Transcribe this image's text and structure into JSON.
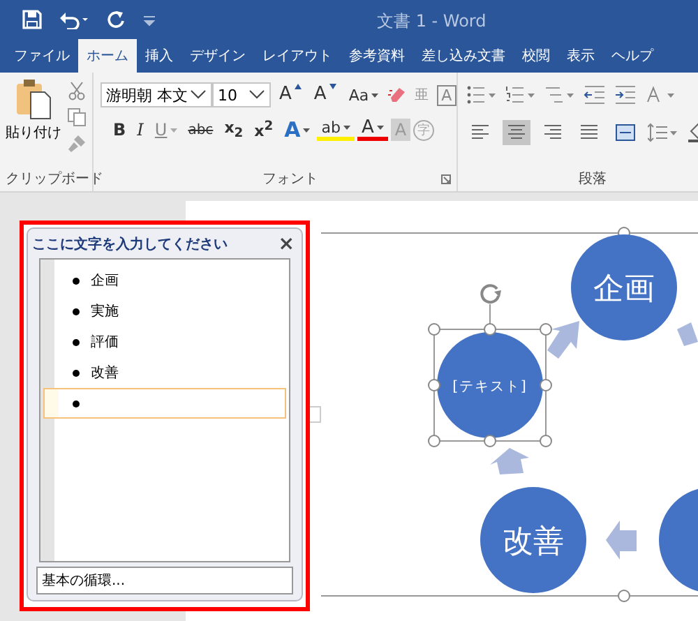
{
  "window": {
    "title": "文書 1  -  Word"
  },
  "tabs": [
    {
      "label": "ファイル",
      "selected": false
    },
    {
      "label": "ホーム",
      "selected": true
    },
    {
      "label": "挿入",
      "selected": false
    },
    {
      "label": "デザイン",
      "selected": false
    },
    {
      "label": "レイアウト",
      "selected": false
    },
    {
      "label": "参考資料",
      "selected": false
    },
    {
      "label": "差し込み文書",
      "selected": false
    },
    {
      "label": "校閲",
      "selected": false
    },
    {
      "label": "表示",
      "selected": false
    },
    {
      "label": "ヘルプ",
      "selected": false
    }
  ],
  "clipboard": {
    "paste_label": "貼り付け",
    "group_label": "クリップボード"
  },
  "font": {
    "name": "游明朝 本文",
    "size": "10",
    "group_label": "フォント",
    "row1": [
      {
        "kind": "grow",
        "label": "A"
      },
      {
        "kind": "shrink",
        "label": "A"
      },
      {
        "kind": "case",
        "label": "Aa"
      },
      {
        "kind": "clear"
      },
      {
        "kind": "phonetic",
        "label": "亜"
      },
      {
        "kind": "border",
        "label": "A"
      }
    ],
    "row2": [
      {
        "kind": "bold",
        "label": "B"
      },
      {
        "kind": "italic",
        "label": "I"
      },
      {
        "kind": "underline",
        "label": "U"
      },
      {
        "kind": "strike",
        "label": "abc"
      },
      {
        "kind": "script",
        "label": "x$_{2}$"
      },
      {
        "kind": "script",
        "label": "x$^{2}$"
      },
      {
        "kind": "effect",
        "label": "A"
      },
      {
        "kind": "highlight",
        "label": "ab"
      },
      {
        "kind": "color",
        "label": "A"
      },
      {
        "kind": "shade",
        "label": "A"
      },
      {
        "kind": "enclose",
        "label": "字"
      }
    ]
  },
  "paragraph": {
    "group_label": "段落",
    "align": [
      {
        "kind": "left",
        "selected": false
      },
      {
        "kind": "center",
        "selected": true
      },
      {
        "kind": "right",
        "selected": false
      },
      {
        "kind": "justify",
        "selected": false
      },
      {
        "kind": "distribute",
        "selected": false
      }
    ]
  },
  "text_pane": {
    "title": "ここに文字を入力してください",
    "close": "×",
    "items": [
      {
        "text": "企画",
        "active": false
      },
      {
        "text": "実施",
        "active": false
      },
      {
        "text": "評価",
        "active": false
      },
      {
        "text": "改善",
        "active": false
      },
      {
        "active": true
      }
    ],
    "footer": "基本の循環..."
  },
  "diagram": {
    "nodes": [
      {
        "text": "企画",
        "selected": false
      },
      {
        "placeholder": "[テキスト]",
        "selected": true
      },
      {
        "text": "改善",
        "selected": false
      },
      {
        "selected": false
      }
    ]
  }
}
